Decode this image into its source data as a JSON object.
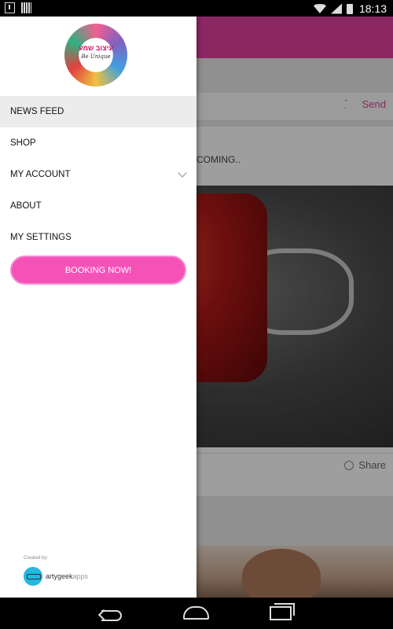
{
  "status_bar": {
    "time": "18:13",
    "icons": [
      "download-icon",
      "barcode-icon",
      "wifi-icon",
      "signal-icon",
      "battery-icon"
    ]
  },
  "drawer": {
    "logo": {
      "text_hebrew": "עיצוב שמע",
      "text_tagline": "Be Unique"
    },
    "menu": [
      {
        "label": "NEWS FEED",
        "active": true
      },
      {
        "label": "SHOP"
      },
      {
        "label": "MY ACCOUNT",
        "has_chevron": true
      },
      {
        "label": "ABOUT"
      },
      {
        "label": "MY SETTINGS"
      }
    ],
    "booking_button": "BOOKING NOW!",
    "credit": {
      "label": "Created by:",
      "brand_main": "artygeek",
      "brand_sub": "apps"
    }
  },
  "background_app": {
    "send_label": "Send",
    "feed_text": "COMING..",
    "share_label": "Share"
  },
  "colors": {
    "accent": "#e040a0",
    "booking_button": "#f552b8"
  },
  "navigation_bar": {
    "icons": [
      "back-icon",
      "home-icon",
      "recent-apps-icon"
    ]
  }
}
